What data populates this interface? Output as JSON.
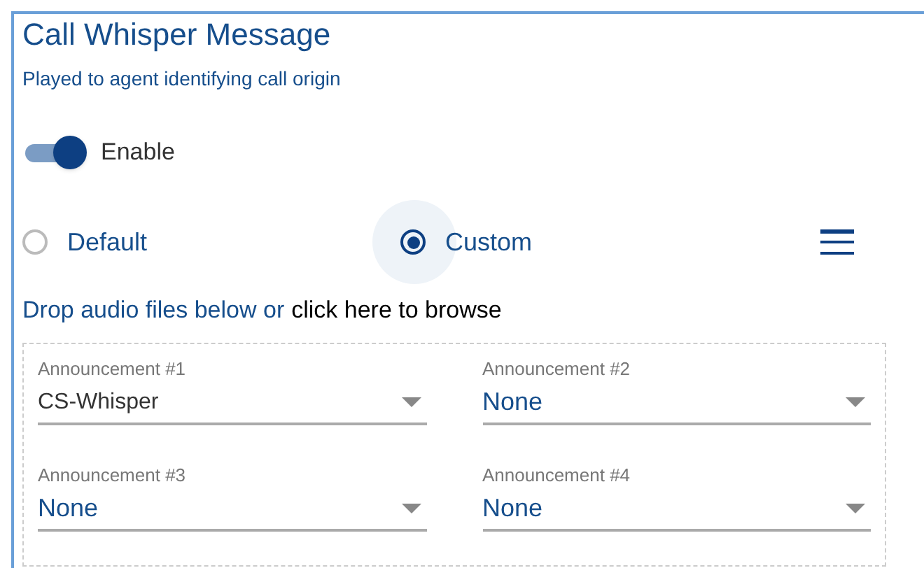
{
  "title": "Call Whisper Message",
  "subtitle": "Played to agent identifying call origin",
  "toggle": {
    "label": "Enable",
    "on": true
  },
  "options": [
    {
      "label": "Default",
      "selected": false
    },
    {
      "label": "Custom",
      "selected": true
    }
  ],
  "drop": {
    "text": "Drop audio files below or",
    "link": "click here to browse"
  },
  "selects": [
    {
      "label": "Announcement #1",
      "value": "CS-Whisper",
      "kind": "file"
    },
    {
      "label": "Announcement #2",
      "value": "None",
      "kind": "empty"
    },
    {
      "label": "Announcement #3",
      "value": "None",
      "kind": "empty"
    },
    {
      "label": "Announcement #4",
      "value": "None",
      "kind": "empty"
    }
  ]
}
